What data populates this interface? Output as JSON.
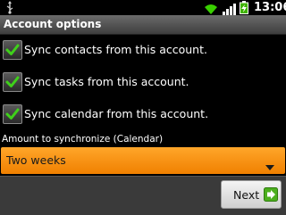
{
  "status_bar": {
    "time": "13:06",
    "icons": [
      "usb-icon",
      "wifi-icon",
      "signal-icon",
      "battery-charging-icon"
    ]
  },
  "title_bar": {
    "title": "Account options"
  },
  "options": [
    {
      "label": "Sync contacts from this account.",
      "checked": true
    },
    {
      "label": "Sync tasks from this account.",
      "checked": true
    },
    {
      "label": "Sync calendar from this account.",
      "checked": true
    }
  ],
  "sync_amount": {
    "label": "Amount to synchronize (Calendar)",
    "selected": "Two weeks"
  },
  "footer": {
    "next_label": "Next"
  },
  "colors": {
    "accent_orange": "#f59000",
    "check_green": "#3fd11a",
    "next_icon_green": "#4caf1e"
  }
}
